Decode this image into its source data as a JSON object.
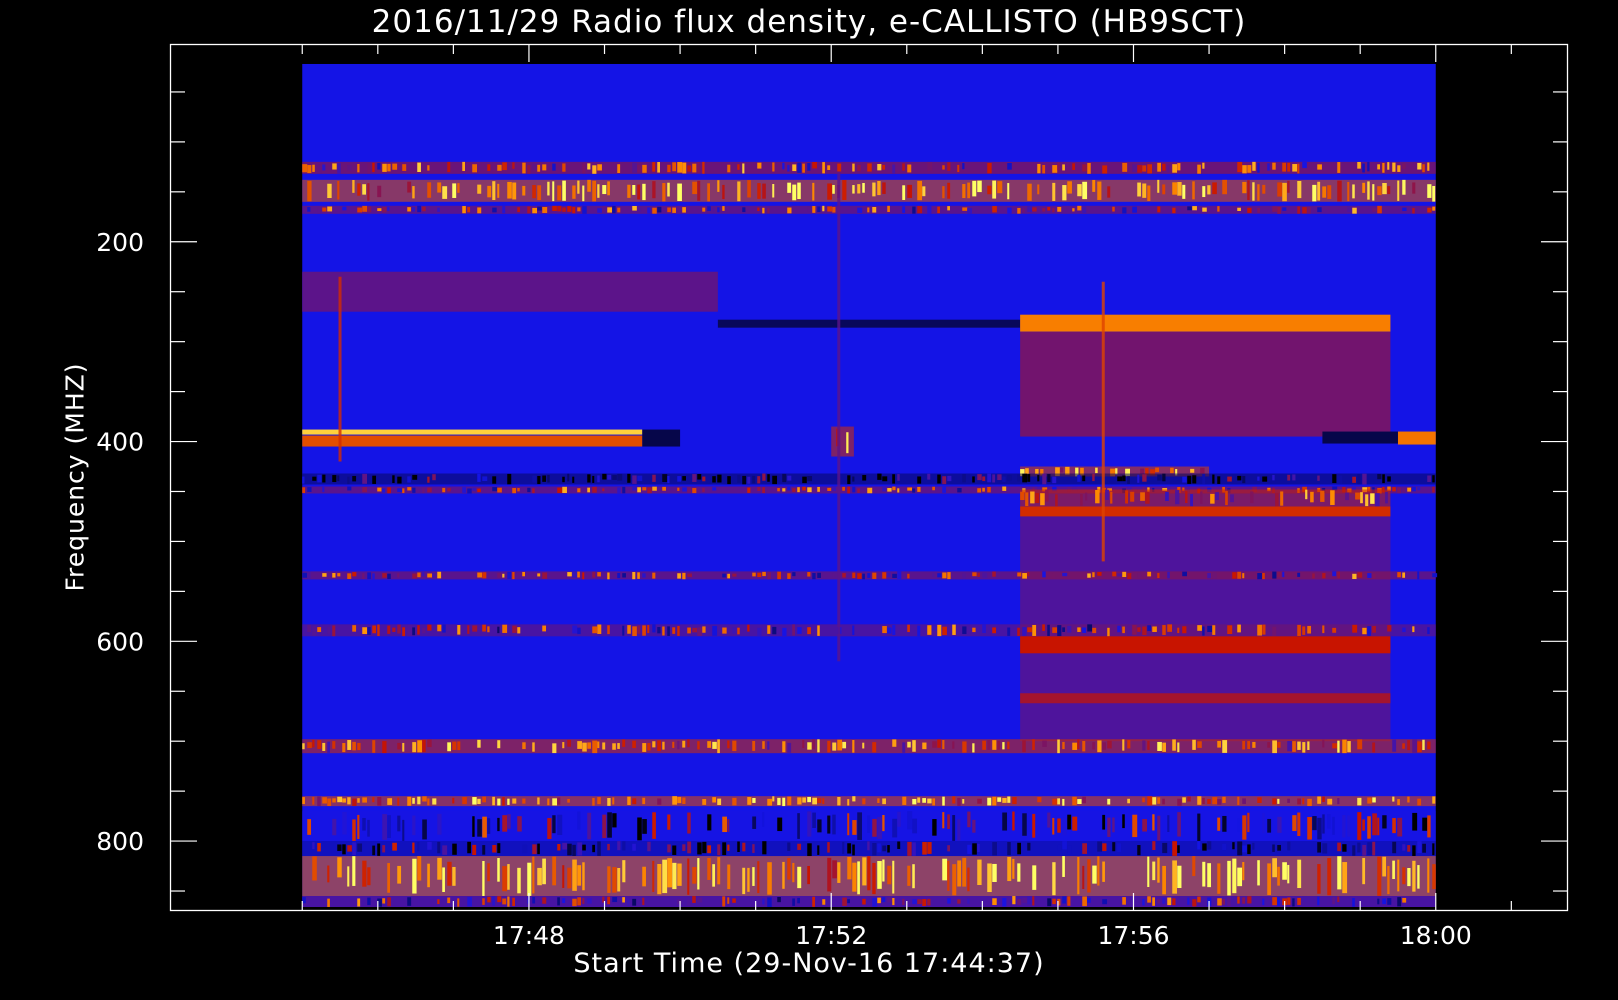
{
  "chart_data": {
    "type": "heatmap",
    "title": "2016/11/29  Radio flux density, e-CALLISTO (HB9SCT)",
    "xlabel": "Start Time (29-Nov-16 17:44:37)",
    "ylabel": "Frequency (MHZ)",
    "x_unit": "minutes after 17:00 UT",
    "x_ticks": [
      {
        "label": "17:48",
        "value": 48
      },
      {
        "label": "17:52",
        "value": 52
      },
      {
        "label": "17:56",
        "value": 56
      },
      {
        "label": "18:00",
        "value": 60
      }
    ],
    "x_minor_ticks": [
      45,
      46,
      47,
      49,
      50,
      51,
      53,
      54,
      55,
      57,
      58,
      59,
      61
    ],
    "y_ticks": [
      {
        "label": "200",
        "value": 200
      },
      {
        "label": "400",
        "value": 400
      },
      {
        "label": "600",
        "value": 600
      },
      {
        "label": "800",
        "value": 800
      }
    ],
    "y_minor_ticks": [
      50,
      100,
      150,
      250,
      300,
      350,
      450,
      500,
      550,
      650,
      700,
      750,
      850
    ],
    "xlim": [
      43.25,
      61.75
    ],
    "ylim": [
      870,
      2
    ],
    "data_extent": {
      "x": [
        45,
        60
      ],
      "y": [
        22,
        866
      ]
    },
    "y_reversed": true,
    "colormap": [
      "#000000",
      "#1414e6",
      "#c81400",
      "#ff8c00",
      "#ffff64"
    ],
    "background_color": "#1414e6",
    "bands": [
      {
        "y": [
          120,
          132
        ],
        "x": [
          45,
          60
        ],
        "level": 0.55,
        "pattern": "speckle"
      },
      {
        "y": [
          138,
          160
        ],
        "x": [
          45,
          60
        ],
        "level": 0.75,
        "pattern": "speckle"
      },
      {
        "y": [
          164,
          172
        ],
        "x": [
          45,
          60
        ],
        "level": 0.5,
        "pattern": "speckle"
      },
      {
        "y": [
          230,
          270
        ],
        "x": [
          45,
          50.5
        ],
        "level": 0.35,
        "pattern": "solid"
      },
      {
        "y": [
          278,
          286
        ],
        "x": [
          50.5,
          54.5
        ],
        "level": 0.1,
        "pattern": "solid"
      },
      {
        "y": [
          273,
          290
        ],
        "x": [
          54.5,
          59.4
        ],
        "level": 0.72,
        "pattern": "solid"
      },
      {
        "y": [
          290,
          395
        ],
        "x": [
          54.5,
          59.4
        ],
        "level": 0.38,
        "pattern": "solid"
      },
      {
        "y": [
          388,
          393
        ],
        "x": [
          45,
          49.5
        ],
        "level": 0.9,
        "pattern": "solid"
      },
      {
        "y": [
          394,
          405
        ],
        "x": [
          45,
          49.5
        ],
        "level": 0.62,
        "pattern": "solid"
      },
      {
        "y": [
          388,
          405
        ],
        "x": [
          49.5,
          50
        ],
        "level": 0.08,
        "pattern": "solid"
      },
      {
        "y": [
          385,
          415
        ],
        "x": [
          52,
          52.3
        ],
        "level": 0.65,
        "pattern": "speckle"
      },
      {
        "y": [
          390,
          402
        ],
        "x": [
          58.5,
          59.5
        ],
        "level": 0.08,
        "pattern": "solid"
      },
      {
        "y": [
          390,
          403
        ],
        "x": [
          59.5,
          60
        ],
        "level": 0.7,
        "pattern": "solid"
      },
      {
        "y": [
          425,
          435
        ],
        "x": [
          54.5,
          57
        ],
        "level": 0.7,
        "pattern": "speckle"
      },
      {
        "y": [
          432,
          443
        ],
        "x": [
          45,
          60
        ],
        "level": 0.12,
        "pattern": "speckle"
      },
      {
        "y": [
          445,
          452
        ],
        "x": [
          45,
          60
        ],
        "level": 0.5,
        "pattern": "speckle"
      },
      {
        "y": [
          448,
          465
        ],
        "x": [
          54.5,
          59.4
        ],
        "level": 0.62,
        "pattern": "speckle"
      },
      {
        "y": [
          465,
          475
        ],
        "x": [
          54.5,
          59.4
        ],
        "level": 0.55,
        "pattern": "solid"
      },
      {
        "y": [
          475,
          700
        ],
        "x": [
          54.5,
          59.4
        ],
        "level": 0.33,
        "pattern": "solid"
      },
      {
        "y": [
          530,
          538
        ],
        "x": [
          45,
          60
        ],
        "level": 0.5,
        "pattern": "speckle"
      },
      {
        "y": [
          583,
          595
        ],
        "x": [
          45,
          60
        ],
        "level": 0.45,
        "pattern": "speckle"
      },
      {
        "y": [
          595,
          612
        ],
        "x": [
          54.5,
          59.4
        ],
        "level": 0.5,
        "pattern": "solid"
      },
      {
        "y": [
          652,
          662
        ],
        "x": [
          54.5,
          59.4
        ],
        "level": 0.45,
        "pattern": "solid"
      },
      {
        "y": [
          698,
          712
        ],
        "x": [
          45,
          60
        ],
        "level": 0.65,
        "pattern": "speckle"
      },
      {
        "y": [
          755,
          765
        ],
        "x": [
          45,
          60
        ],
        "level": 0.72,
        "pattern": "speckle"
      },
      {
        "y": [
          770,
          800
        ],
        "x": [
          45,
          60
        ],
        "level": 0.3,
        "pattern": "speckle"
      },
      {
        "y": [
          800,
          815
        ],
        "x": [
          45,
          60
        ],
        "level": 0.2,
        "pattern": "speckle"
      },
      {
        "y": [
          815,
          855
        ],
        "x": [
          45,
          60
        ],
        "level": 0.8,
        "pattern": "speckle"
      },
      {
        "y": [
          855,
          866
        ],
        "x": [
          45,
          60
        ],
        "level": 0.45,
        "pattern": "speckle"
      }
    ],
    "spikes": [
      {
        "x": 45.5,
        "y": [
          235,
          420
        ],
        "level": 0.55
      },
      {
        "x": 52.1,
        "y": [
          130,
          620
        ],
        "level": 0.35
      },
      {
        "x": 55.6,
        "y": [
          240,
          520
        ],
        "level": 0.6
      }
    ]
  }
}
